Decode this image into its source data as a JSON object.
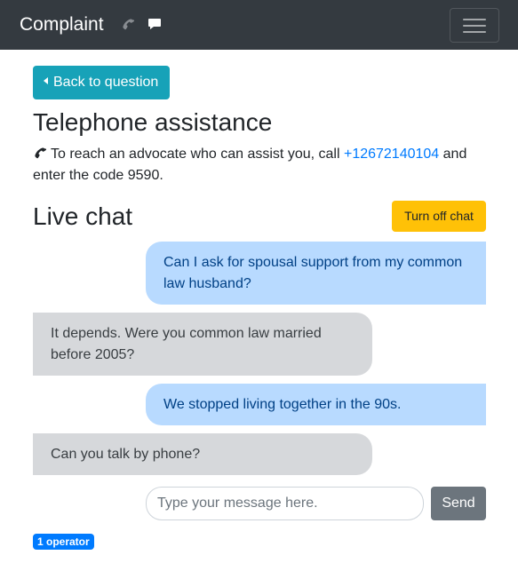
{
  "navbar": {
    "brand": "Complaint",
    "icons": [
      "phone-icon",
      "chat-icon",
      "hamburger-menu-icon"
    ]
  },
  "back_button": {
    "label": "Back to question"
  },
  "telephone": {
    "heading": "Telephone assistance",
    "text_before": "To reach an advocate who can assist you, call ",
    "phone_number": "+12672140104",
    "text_after": " and enter the code 9590."
  },
  "chat": {
    "heading": "Live chat",
    "turn_off_label": "Turn off chat",
    "messages": [
      {
        "direction": "out",
        "text": "Can I ask for spousal support from my common law husband?"
      },
      {
        "direction": "in",
        "text": "It depends. Were you common law married before 2005?"
      },
      {
        "direction": "out",
        "text": "We stopped living together in the 90s."
      },
      {
        "direction": "in",
        "text": "Can you talk by phone?"
      }
    ],
    "input_placeholder": "Type your message here.",
    "send_label": "Send",
    "operator_badge": "1 operator"
  },
  "colors": {
    "navbar_bg": "#343a40",
    "info": "#17a2b8",
    "warning": "#ffc107",
    "secondary": "#6c757d",
    "primary": "#007bff",
    "outgoing_bubble": "#b8daff",
    "incoming_bubble": "#d6d8db"
  }
}
